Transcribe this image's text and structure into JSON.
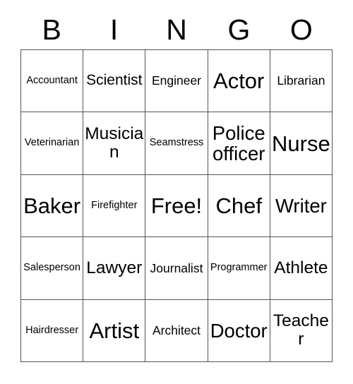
{
  "card": {
    "title": "BINGO",
    "header_letters": [
      "B",
      "I",
      "N",
      "G",
      "O"
    ],
    "free_space_label": "Free!",
    "colors": {
      "background": "#ffffff",
      "text": "#000000",
      "grid_line": "#555555"
    },
    "grid": {
      "columns": 5,
      "rows": 5,
      "rows_data": [
        [
          {
            "label": "Accountant",
            "size": "xs"
          },
          {
            "label": "Scientist",
            "size": "m"
          },
          {
            "label": "Engineer",
            "size": "s"
          },
          {
            "label": "Actor",
            "size": "xxl"
          },
          {
            "label": "Librarian",
            "size": "s"
          }
        ],
        [
          {
            "label": "Veterinarian",
            "size": "xs"
          },
          {
            "label": "Musician",
            "size": "l"
          },
          {
            "label": "Seamstress",
            "size": "xs"
          },
          {
            "label": "Police officer",
            "size": "xl"
          },
          {
            "label": "Nurse",
            "size": "xxl"
          }
        ],
        [
          {
            "label": "Baker",
            "size": "xxl"
          },
          {
            "label": "Firefighter",
            "size": "xs"
          },
          {
            "label": "Free!",
            "size": "xxl"
          },
          {
            "label": "Chef",
            "size": "xxl"
          },
          {
            "label": "Writer",
            "size": "xl"
          }
        ],
        [
          {
            "label": "Salesperson",
            "size": "xs"
          },
          {
            "label": "Lawyer",
            "size": "l"
          },
          {
            "label": "Journalist",
            "size": "s"
          },
          {
            "label": "Programmer",
            "size": "xs"
          },
          {
            "label": "Athlete",
            "size": "l"
          }
        ],
        [
          {
            "label": "Hairdresser",
            "size": "xs"
          },
          {
            "label": "Artist",
            "size": "xxl"
          },
          {
            "label": "Architect",
            "size": "s"
          },
          {
            "label": "Doctor",
            "size": "xl"
          },
          {
            "label": "Teacher",
            "size": "l"
          }
        ]
      ]
    }
  }
}
